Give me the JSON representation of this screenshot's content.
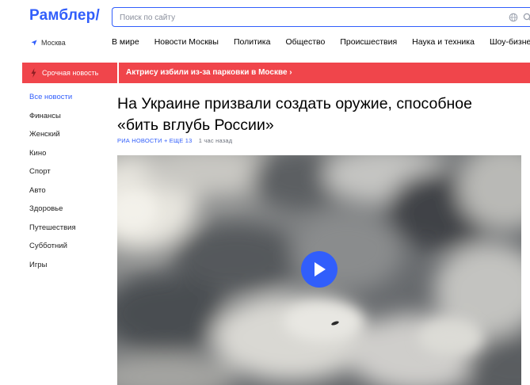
{
  "header": {
    "logo": "Рамблер/",
    "search_placeholder": "Поиск по сайту",
    "location": "Москва"
  },
  "topnav": [
    "В мире",
    "Новости Москвы",
    "Политика",
    "Общество",
    "Происшествия",
    "Наука и техника",
    "Шоу-бизнес"
  ],
  "breaking": {
    "label": "Срочная новость",
    "headline": "Актрису избили из-за парковки в Москве ›"
  },
  "sidebar": {
    "items": [
      "Все новости",
      "Финансы",
      "Женский",
      "Кино",
      "Спорт",
      "Авто",
      "Здоровье",
      "Путешествия",
      "Субботний",
      "Игры"
    ]
  },
  "article": {
    "title": "На Украине призвали создать оружие, способное «бить вглубь России»",
    "source": "РИА Новости + еще 13",
    "time": "1 час назад"
  },
  "colors": {
    "accent": "#315efb",
    "breaking": "#f0454b"
  }
}
